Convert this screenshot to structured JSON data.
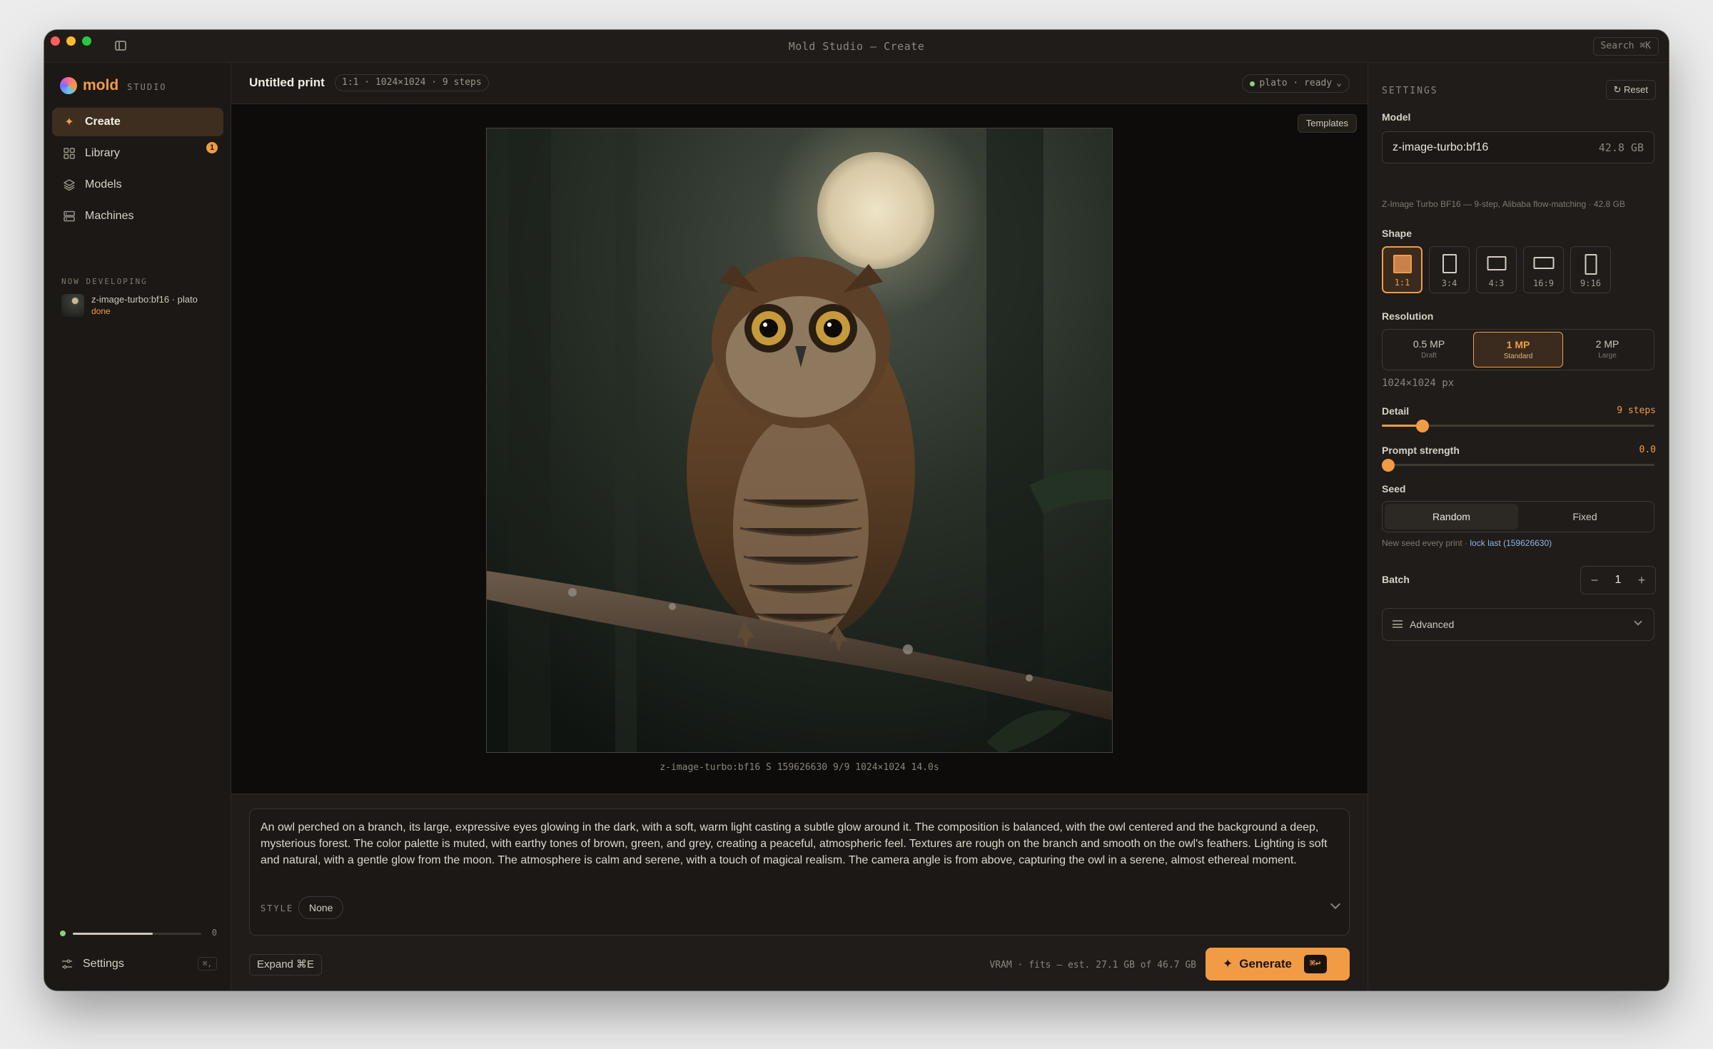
{
  "window": {
    "title": "Mold Studio — Create",
    "search_label": "Search ⌘K"
  },
  "brand": {
    "name": "mold",
    "sub": "STUDIO"
  },
  "sidebar": {
    "items": [
      {
        "label": "Create",
        "icon": "sparkle-icon",
        "active": true
      },
      {
        "label": "Library",
        "icon": "grid-icon",
        "badge": "1"
      },
      {
        "label": "Models",
        "icon": "layers-icon"
      },
      {
        "label": "Machines",
        "icon": "server-icon"
      }
    ],
    "section_label": "NOW DEVELOPING",
    "developing": {
      "title": "z-image-turbo:bf16 · plato",
      "status": "done"
    },
    "progress_value": "0",
    "progress_fraction": 0.62,
    "settings_label": "Settings",
    "settings_kbd": "⌘,"
  },
  "header": {
    "title": "Untitled print",
    "meta": "1:1 · 1024×1024 · 9 steps",
    "machine": "plato · ready"
  },
  "canvas": {
    "templates_label": "Templates",
    "caption": "z-image-turbo:bf16 S 159626630 9/9 1024×1024 14.0s"
  },
  "prompt": {
    "text": "An owl perched on a branch, its large, expressive eyes glowing in the dark, with a soft, warm light casting a subtle glow around it. The composition is balanced, with the owl centered and the background a deep, mysterious forest. The color palette is muted, with earthy tones of brown, green, and grey, creating a peaceful, atmospheric feel. Textures are rough on the branch and smooth on the owl's feathers. Lighting is soft and natural, with a gentle glow from the moon. The atmosphere is calm and serene, with a touch of magical realism. The camera angle is from above, capturing the owl in a serene, almost ethereal moment.",
    "style_label": "STYLE",
    "style_value": "None",
    "expand_label": "Expand ⌘E",
    "vram": "VRAM · fits — est. 27.1 GB of 46.7 GB",
    "generate_label": "Generate",
    "generate_kbd": "⌘↩"
  },
  "settings": {
    "header": "SETTINGS",
    "reset_label": "Reset",
    "model_label": "Model",
    "model_name": "z-image-turbo:bf16",
    "model_size": "42.8 GB",
    "model_desc": "Z-Image Turbo BF16 — 9-step, Alibaba flow-matching · 42.8 GB",
    "shape_label": "Shape",
    "shapes": [
      "1:1",
      "3:4",
      "4:3",
      "16:9",
      "9:16"
    ],
    "resolution_label": "Resolution",
    "resolutions": [
      {
        "main": "0.5 MP",
        "sub": "Draft"
      },
      {
        "main": "1 MP",
        "sub": "Standard"
      },
      {
        "main": "2 MP",
        "sub": "Large"
      }
    ],
    "resolution_px": "1024×1024 px",
    "detail_label": "Detail",
    "detail_value": "9 steps",
    "detail_fraction": 0.15,
    "prompt_strength_label": "Prompt strength",
    "prompt_strength_value": "0.0",
    "prompt_strength_fraction": 0.0,
    "seed_label": "Seed",
    "seed_options": [
      "Random",
      "Fixed"
    ],
    "seed_note": "New seed every print · ",
    "seed_link": "lock last (159626630)",
    "batch_label": "Batch",
    "batch_value": "1",
    "advanced_label": "Advanced"
  },
  "colors": {
    "accent": "#f29b45",
    "ready": "#8bd17c",
    "link": "#8fb5e6"
  }
}
